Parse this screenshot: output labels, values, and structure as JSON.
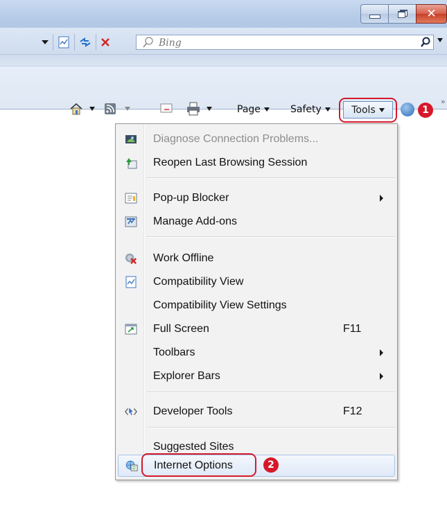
{
  "address_bar": {
    "search_placeholder": "Bing"
  },
  "command_bar": {
    "page_label": "Page",
    "safety_label": "Safety",
    "tools_label": "Tools"
  },
  "callouts": {
    "step1": "1",
    "step2": "2"
  },
  "tools_menu": {
    "items": [
      {
        "label": "Diagnose Connection Problems...",
        "enabled": false,
        "icon": "diagnose-icon"
      },
      {
        "label": "Reopen Last Browsing Session",
        "icon": "reopen-session-icon"
      },
      {
        "label": "Pop-up Blocker",
        "icon": "popup-blocker-icon",
        "submenu": true
      },
      {
        "label": "Manage Add-ons",
        "icon": "addons-icon"
      },
      {
        "label": "Work Offline",
        "icon": "work-offline-icon"
      },
      {
        "label": "Compatibility View",
        "icon": "compatibility-view-icon"
      },
      {
        "label": "Compatibility View Settings"
      },
      {
        "label": "Full Screen",
        "icon": "full-screen-icon",
        "shortcut": "F11"
      },
      {
        "label": "Toolbars",
        "submenu": true
      },
      {
        "label": "Explorer Bars",
        "submenu": true
      },
      {
        "label": "Developer Tools",
        "icon": "developer-tools-icon",
        "shortcut": "F12"
      },
      {
        "label": "Suggested Sites"
      },
      {
        "label": "Internet Options",
        "icon": "internet-options-icon",
        "highlighted": true
      }
    ]
  },
  "colors": {
    "callout_red": "#d6182a",
    "chrome_blue": "#c9daf0",
    "menu_bg": "#f2f2f2",
    "highlight_border": "#a9c3e6"
  }
}
